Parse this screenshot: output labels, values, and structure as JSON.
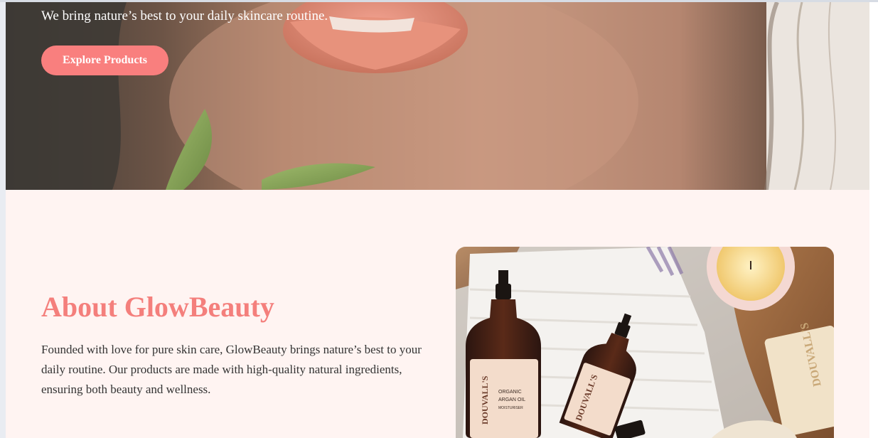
{
  "hero": {
    "subtitle": "We bring nature’s best to your daily skincare routine.",
    "cta_label": "Explore Products"
  },
  "about": {
    "title": "About GlowBeauty",
    "description": "Founded with love for pure skin care, GlowBeauty brings nature’s best to your daily routine. Our products are made with high-quality natural ingredients, ensuring both beauty and wellness.",
    "product_image": {
      "bottle_large_brand": "DOUVALL'S",
      "bottle_large_line1": "ORGANIC",
      "bottle_large_line2": "ARGAN OIL",
      "bottle_large_line3": "MOISTURISER",
      "bottle_small_brand": "DOUVALL'S",
      "soap_brand": "DOUVALL'S"
    }
  },
  "colors": {
    "accent": "#f97f7e",
    "title": "#f47f7c",
    "section_bg": "#fff4f2",
    "body_text": "#333333"
  }
}
